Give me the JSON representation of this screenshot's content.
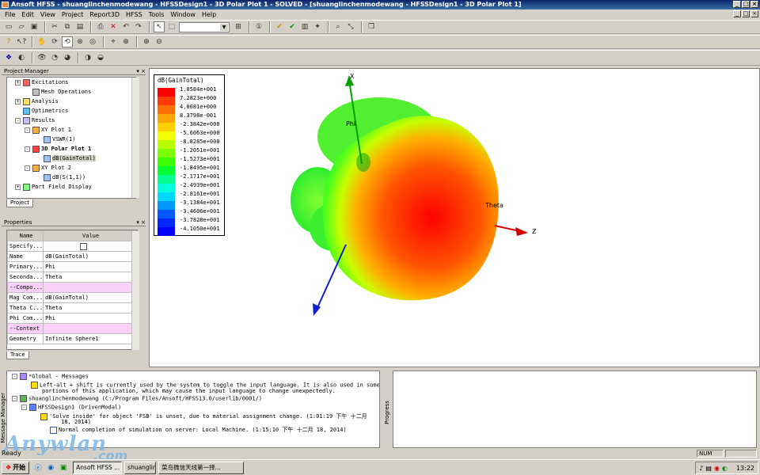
{
  "window": {
    "title": "Ansoft HFSS - shuanglinchenmodewang - HFSSDesign1 - 3D Polar Plot 1 - SOLVED - [shuanglinchenmodewang - HFSSDesign1 - 3D Polar Plot 1]",
    "app_name": "Ansoft HFSS"
  },
  "menu": [
    "File",
    "Edit",
    "View",
    "Project",
    "Report3D",
    "HFSS",
    "Tools",
    "Window",
    "Help"
  ],
  "project_manager": {
    "title": "Project Manager",
    "tab": "Project",
    "items": [
      {
        "label": "Excitations",
        "icon": "excitations-icon"
      },
      {
        "label": "Mesh Operations",
        "icon": "mesh-icon"
      },
      {
        "label": "Analysis",
        "icon": "analysis-icon"
      },
      {
        "label": "Optimetrics",
        "icon": "optimetrics-icon"
      },
      {
        "label": "Results",
        "icon": "results-icon"
      },
      {
        "label": "XY Plot 1",
        "icon": "xy-plot-icon"
      },
      {
        "label": "VSWR(1)",
        "icon": "trace-icon"
      },
      {
        "label": "3D Polar Plot 1",
        "icon": "polar-plot-icon"
      },
      {
        "label": "dB(GainTotal)",
        "icon": "trace-icon"
      },
      {
        "label": "XY Plot 2",
        "icon": "xy-plot-icon"
      },
      {
        "label": "dB(S(1,1))",
        "icon": "trace-icon"
      },
      {
        "label": "Port Field Display",
        "icon": "field-icon"
      }
    ]
  },
  "properties": {
    "title": "Properties",
    "tab": "Trace",
    "headers": [
      "Name",
      "Value"
    ],
    "rows": [
      {
        "name": "Specify...",
        "value": ""
      },
      {
        "name": "Name",
        "value": "dB(GainTotal)"
      },
      {
        "name": "Primary...",
        "value": "Phi"
      },
      {
        "name": "Seconda...",
        "value": "Theta"
      },
      {
        "name": "--Compo...",
        "value": ""
      },
      {
        "name": "Mag Com...",
        "value": "dB(GainTotal)"
      },
      {
        "name": "Theta C...",
        "value": "Theta"
      },
      {
        "name": "Phi Com...",
        "value": "Phi"
      },
      {
        "name": "--Context",
        "value": ""
      },
      {
        "name": "Geometry",
        "value": "Infinite Sphere1"
      }
    ]
  },
  "legend": {
    "title": "dB(GainTotal)",
    "entries": [
      {
        "value": "1.0584e+001",
        "color": "#ff0000"
      },
      {
        "value": "7.2823e+000",
        "color": "#ff3a00"
      },
      {
        "value": "4.0081e+000",
        "color": "#ff7000"
      },
      {
        "value": "8.3798e-001",
        "color": "#ffa500"
      },
      {
        "value": "-2.3842e+000",
        "color": "#ffd000"
      },
      {
        "value": "-5.6063e+000",
        "color": "#f0ff00"
      },
      {
        "value": "-8.8285e+000",
        "color": "#b8ff00"
      },
      {
        "value": "-1.2051e+001",
        "color": "#7cff00"
      },
      {
        "value": "-1.5273e+001",
        "color": "#3cff00"
      },
      {
        "value": "-1.8495e+001",
        "color": "#00ff30"
      },
      {
        "value": "-2.1717e+001",
        "color": "#00ff90"
      },
      {
        "value": "-2.4939e+001",
        "color": "#00ffd8"
      },
      {
        "value": "-2.8161e+001",
        "color": "#00d8ff"
      },
      {
        "value": "-3.1384e+001",
        "color": "#0098ff"
      },
      {
        "value": "-3.4606e+001",
        "color": "#0058ff"
      },
      {
        "value": "-3.7828e+001",
        "color": "#0028ff"
      },
      {
        "value": "-4.1050e+001",
        "color": "#0000ff"
      }
    ]
  },
  "axes": {
    "x": "X",
    "z": "Z",
    "phi": "Phi",
    "theta": "Theta"
  },
  "messages": {
    "global_title": "*Global - Messages",
    "global_warning_1": "Left-alt + shift is currently used by the system to toggle the input language. It is also used in some",
    "global_warning_2": "portions of this application, which may cause the input language to change unexpectedly.",
    "project_path": "shuanglinchenmodewang (C:/Program Files/Ansoft/HFSS13.0/userlib/0001/)",
    "design_title": "HFSSDesign1 (DrivenModal)",
    "warn_1": "'Solve inside' for object 'FSB' is unset, due to material assignment change. (1:01:19 下午  十二月",
    "warn_2": "18, 2014)",
    "info": "Normal completion of simulation on server: Local Machine. (1:15:10 下午  十二月 18, 2014)",
    "panel_label": "Message Manager",
    "progress_label": "Progress"
  },
  "status": {
    "text": "Ready",
    "num": "NUM"
  },
  "taskbar": {
    "start": "开始",
    "buttons": [
      "Ansoft HFSS ...",
      "shuanglin...",
      "菜鸟微信天线第一择..."
    ],
    "time": "13:22"
  },
  "watermark": {
    "main": "Anywlan",
    "sub": ".com"
  }
}
